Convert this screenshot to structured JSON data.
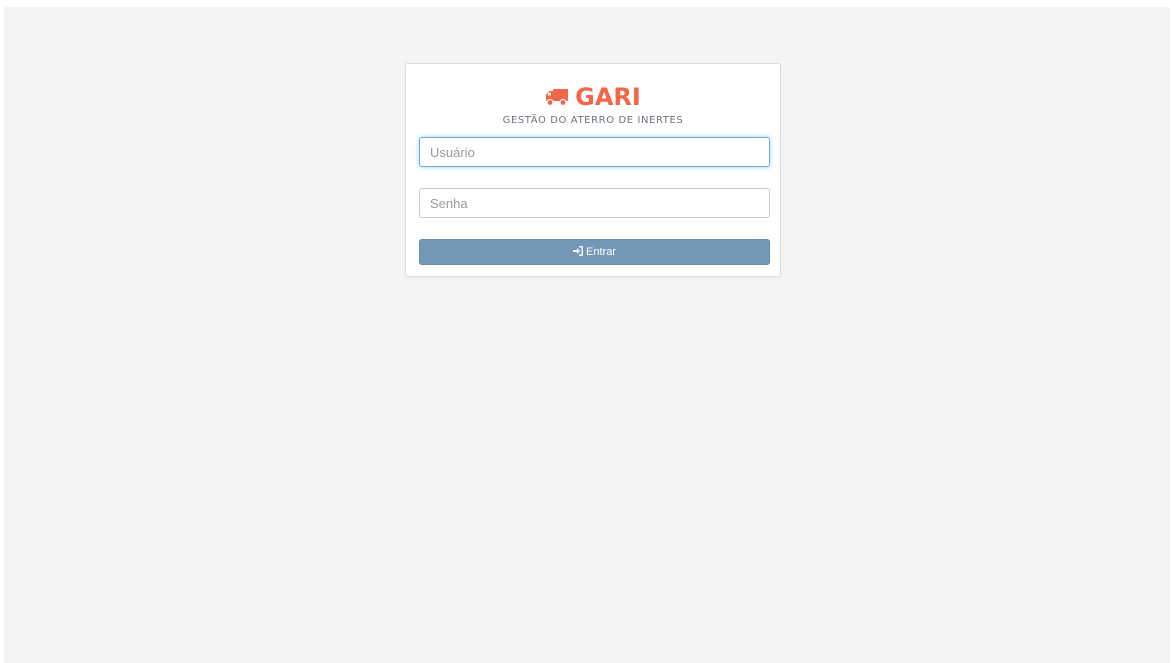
{
  "brand": {
    "name": "GARI",
    "subtitle": "GESTÃO DO ATERRO DE INERTES",
    "icon": "truck-icon",
    "color": "#f2674a"
  },
  "form": {
    "username_placeholder": "Usuário",
    "username_value": "",
    "password_placeholder": "Senha",
    "password_value": "",
    "submit_label": "Entrar",
    "submit_icon": "sign-in-icon",
    "submit_color": "#7397b6"
  }
}
